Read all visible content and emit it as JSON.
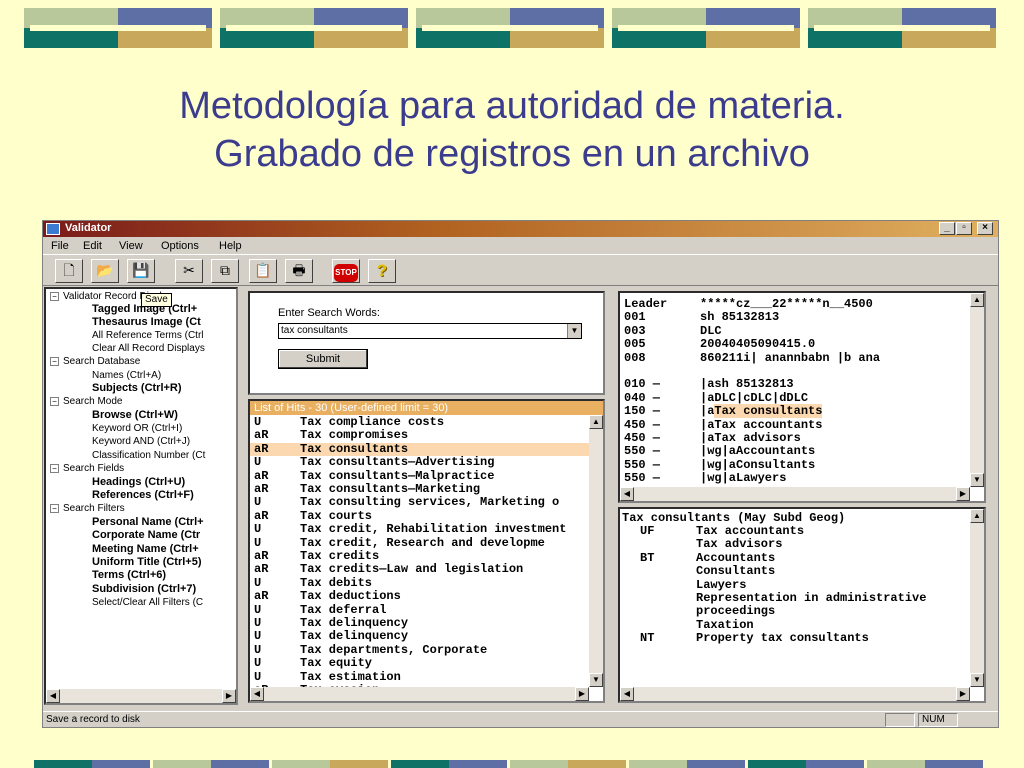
{
  "slide": {
    "title_line1": "Metodología para autoridad de materia.",
    "title_line2": "Grabado de registros en un archivo"
  },
  "window": {
    "title": "Validator",
    "menu": [
      "File",
      "Edit",
      "View",
      "Options",
      "Help"
    ],
    "toolbar": {
      "tooltip": "Save",
      "buttons": [
        "new-icon",
        "open-icon",
        "save-icon",
        "cut-icon",
        "copy-icon",
        "paste-icon",
        "print-icon",
        "stop-icon",
        "help-icon"
      ],
      "stop_label": "STOP",
      "help_glyph": "?"
    },
    "tree": [
      {
        "label": "Validator Record Display",
        "group": true
      },
      {
        "label": "Tagged Image  (Ctrl+",
        "bold": true
      },
      {
        "label": "Thesaurus Image  (Ct",
        "bold": true
      },
      {
        "label": "All Reference Terms  (Ctrl",
        "bold": false
      },
      {
        "label": "Clear All Record Displays",
        "bold": false
      },
      {
        "label": "Search Database",
        "group": true
      },
      {
        "label": "Names  (Ctrl+A)",
        "bold": false
      },
      {
        "label": "Subjects  (Ctrl+R)",
        "bold": true
      },
      {
        "label": "Search Mode",
        "group": true
      },
      {
        "label": "Browse  (Ctrl+W)",
        "bold": true
      },
      {
        "label": "Keyword OR  (Ctrl+I)",
        "bold": false
      },
      {
        "label": "Keyword AND  (Ctrl+J)",
        "bold": false
      },
      {
        "label": "Classification Number  (Ct",
        "bold": false
      },
      {
        "label": "Search Fields",
        "group": true
      },
      {
        "label": "Headings  (Ctrl+U)",
        "bold": true
      },
      {
        "label": "References  (Ctrl+F)",
        "bold": true
      },
      {
        "label": "Search Filters",
        "group": true
      },
      {
        "label": "Personal Name  (Ctrl+",
        "bold": true
      },
      {
        "label": "Corporate Name  (Ctr",
        "bold": true
      },
      {
        "label": "Meeting Name  (Ctrl+",
        "bold": true
      },
      {
        "label": "Uniform Title  (Ctrl+5)",
        "bold": true
      },
      {
        "label": "Terms  (Ctrl+6)",
        "bold": true
      },
      {
        "label": "Subdivision  (Ctrl+7)",
        "bold": true
      },
      {
        "label": "Select/Clear All Filters  (C",
        "bold": false
      }
    ],
    "search": {
      "label": "Enter Search Words:",
      "value": "tax consultants",
      "submit_label": "Submit"
    },
    "hits": {
      "header": "List of Hits - 30  (User-defined limit = 30)",
      "rows": [
        {
          "code": "U",
          "term": "Tax compliance costs"
        },
        {
          "code": "aR",
          "term": "Tax compromises"
        },
        {
          "code": "aR",
          "term": "Tax consultants",
          "selected": true
        },
        {
          "code": "U",
          "term": "Tax consultants—Advertising"
        },
        {
          "code": "aR",
          "term": "Tax consultants—Malpractice"
        },
        {
          "code": "aR",
          "term": "Tax consultants—Marketing"
        },
        {
          "code": "U",
          "term": "Tax consulting services, Marketing o"
        },
        {
          "code": "aR",
          "term": "Tax courts"
        },
        {
          "code": "U",
          "term": "Tax credit, Rehabilitation investment"
        },
        {
          "code": "U",
          "term": "Tax credit, Research and developme"
        },
        {
          "code": "aR",
          "term": "Tax credits"
        },
        {
          "code": "aR",
          "term": "Tax credits—Law and legislation"
        },
        {
          "code": "U",
          "term": "Tax debits"
        },
        {
          "code": "aR",
          "term": "Tax deductions"
        },
        {
          "code": "U",
          "term": "Tax deferral"
        },
        {
          "code": "U",
          "term": "Tax delinquency"
        },
        {
          "code": "U",
          "term": "Tax delinquency"
        },
        {
          "code": "U",
          "term": "Tax departments, Corporate"
        },
        {
          "code": "U",
          "term": "Tax equity"
        },
        {
          "code": "U",
          "term": "Tax estimation"
        },
        {
          "code": "aR",
          "term": "Tax evasion"
        }
      ]
    },
    "marc": [
      {
        "tag": "Leader",
        "value": "*****cz___22*****n__4500"
      },
      {
        "tag": "001",
        "value": "sh 85132813"
      },
      {
        "tag": "003",
        "value": "DLC"
      },
      {
        "tag": "005",
        "value": "20040405090415.0"
      },
      {
        "tag": "008",
        "value": "860211i| anannbabn        |b ana"
      },
      {
        "tag": "",
        "value": ""
      },
      {
        "tag": "010 —",
        "value": "|ash 85132813"
      },
      {
        "tag": "040 —",
        "value": "|aDLC|cDLC|dDLC"
      },
      {
        "tag": "150 —",
        "value": "|aTax consultants",
        "hl": "Tax consultants",
        "pre": "|a"
      },
      {
        "tag": "450 —",
        "value": "|aTax accountants"
      },
      {
        "tag": "450 —",
        "value": "|aTax advisors"
      },
      {
        "tag": "550 —",
        "value": "|wg|aAccountants"
      },
      {
        "tag": "550 —",
        "value": "|wg|aConsultants"
      },
      {
        "tag": "550 —",
        "value": "|wg|aLawyers"
      }
    ],
    "tracings": {
      "heading": "Tax consultants  (May Subd Geog)",
      "rows": [
        {
          "tag": "UF",
          "value": "Tax accountants"
        },
        {
          "tag": "",
          "value": "Tax advisors"
        },
        {
          "tag": "BT",
          "value": "Accountants"
        },
        {
          "tag": "",
          "value": "Consultants"
        },
        {
          "tag": "",
          "value": "Lawyers"
        },
        {
          "tag": "",
          "value": "Representation in administrative"
        },
        {
          "tag": "",
          "value": "proceedings"
        },
        {
          "tag": "",
          "value": "Taxation"
        },
        {
          "tag": "NT",
          "value": "Property tax consultants"
        }
      ]
    },
    "status": {
      "text": "Save a record to disk",
      "num": "NUM"
    }
  },
  "colors": {
    "slide_bg": "#FFFFCC",
    "title": "#3B3C8E",
    "selection": "#FCD8B0",
    "hits_header": "#E8B060"
  }
}
